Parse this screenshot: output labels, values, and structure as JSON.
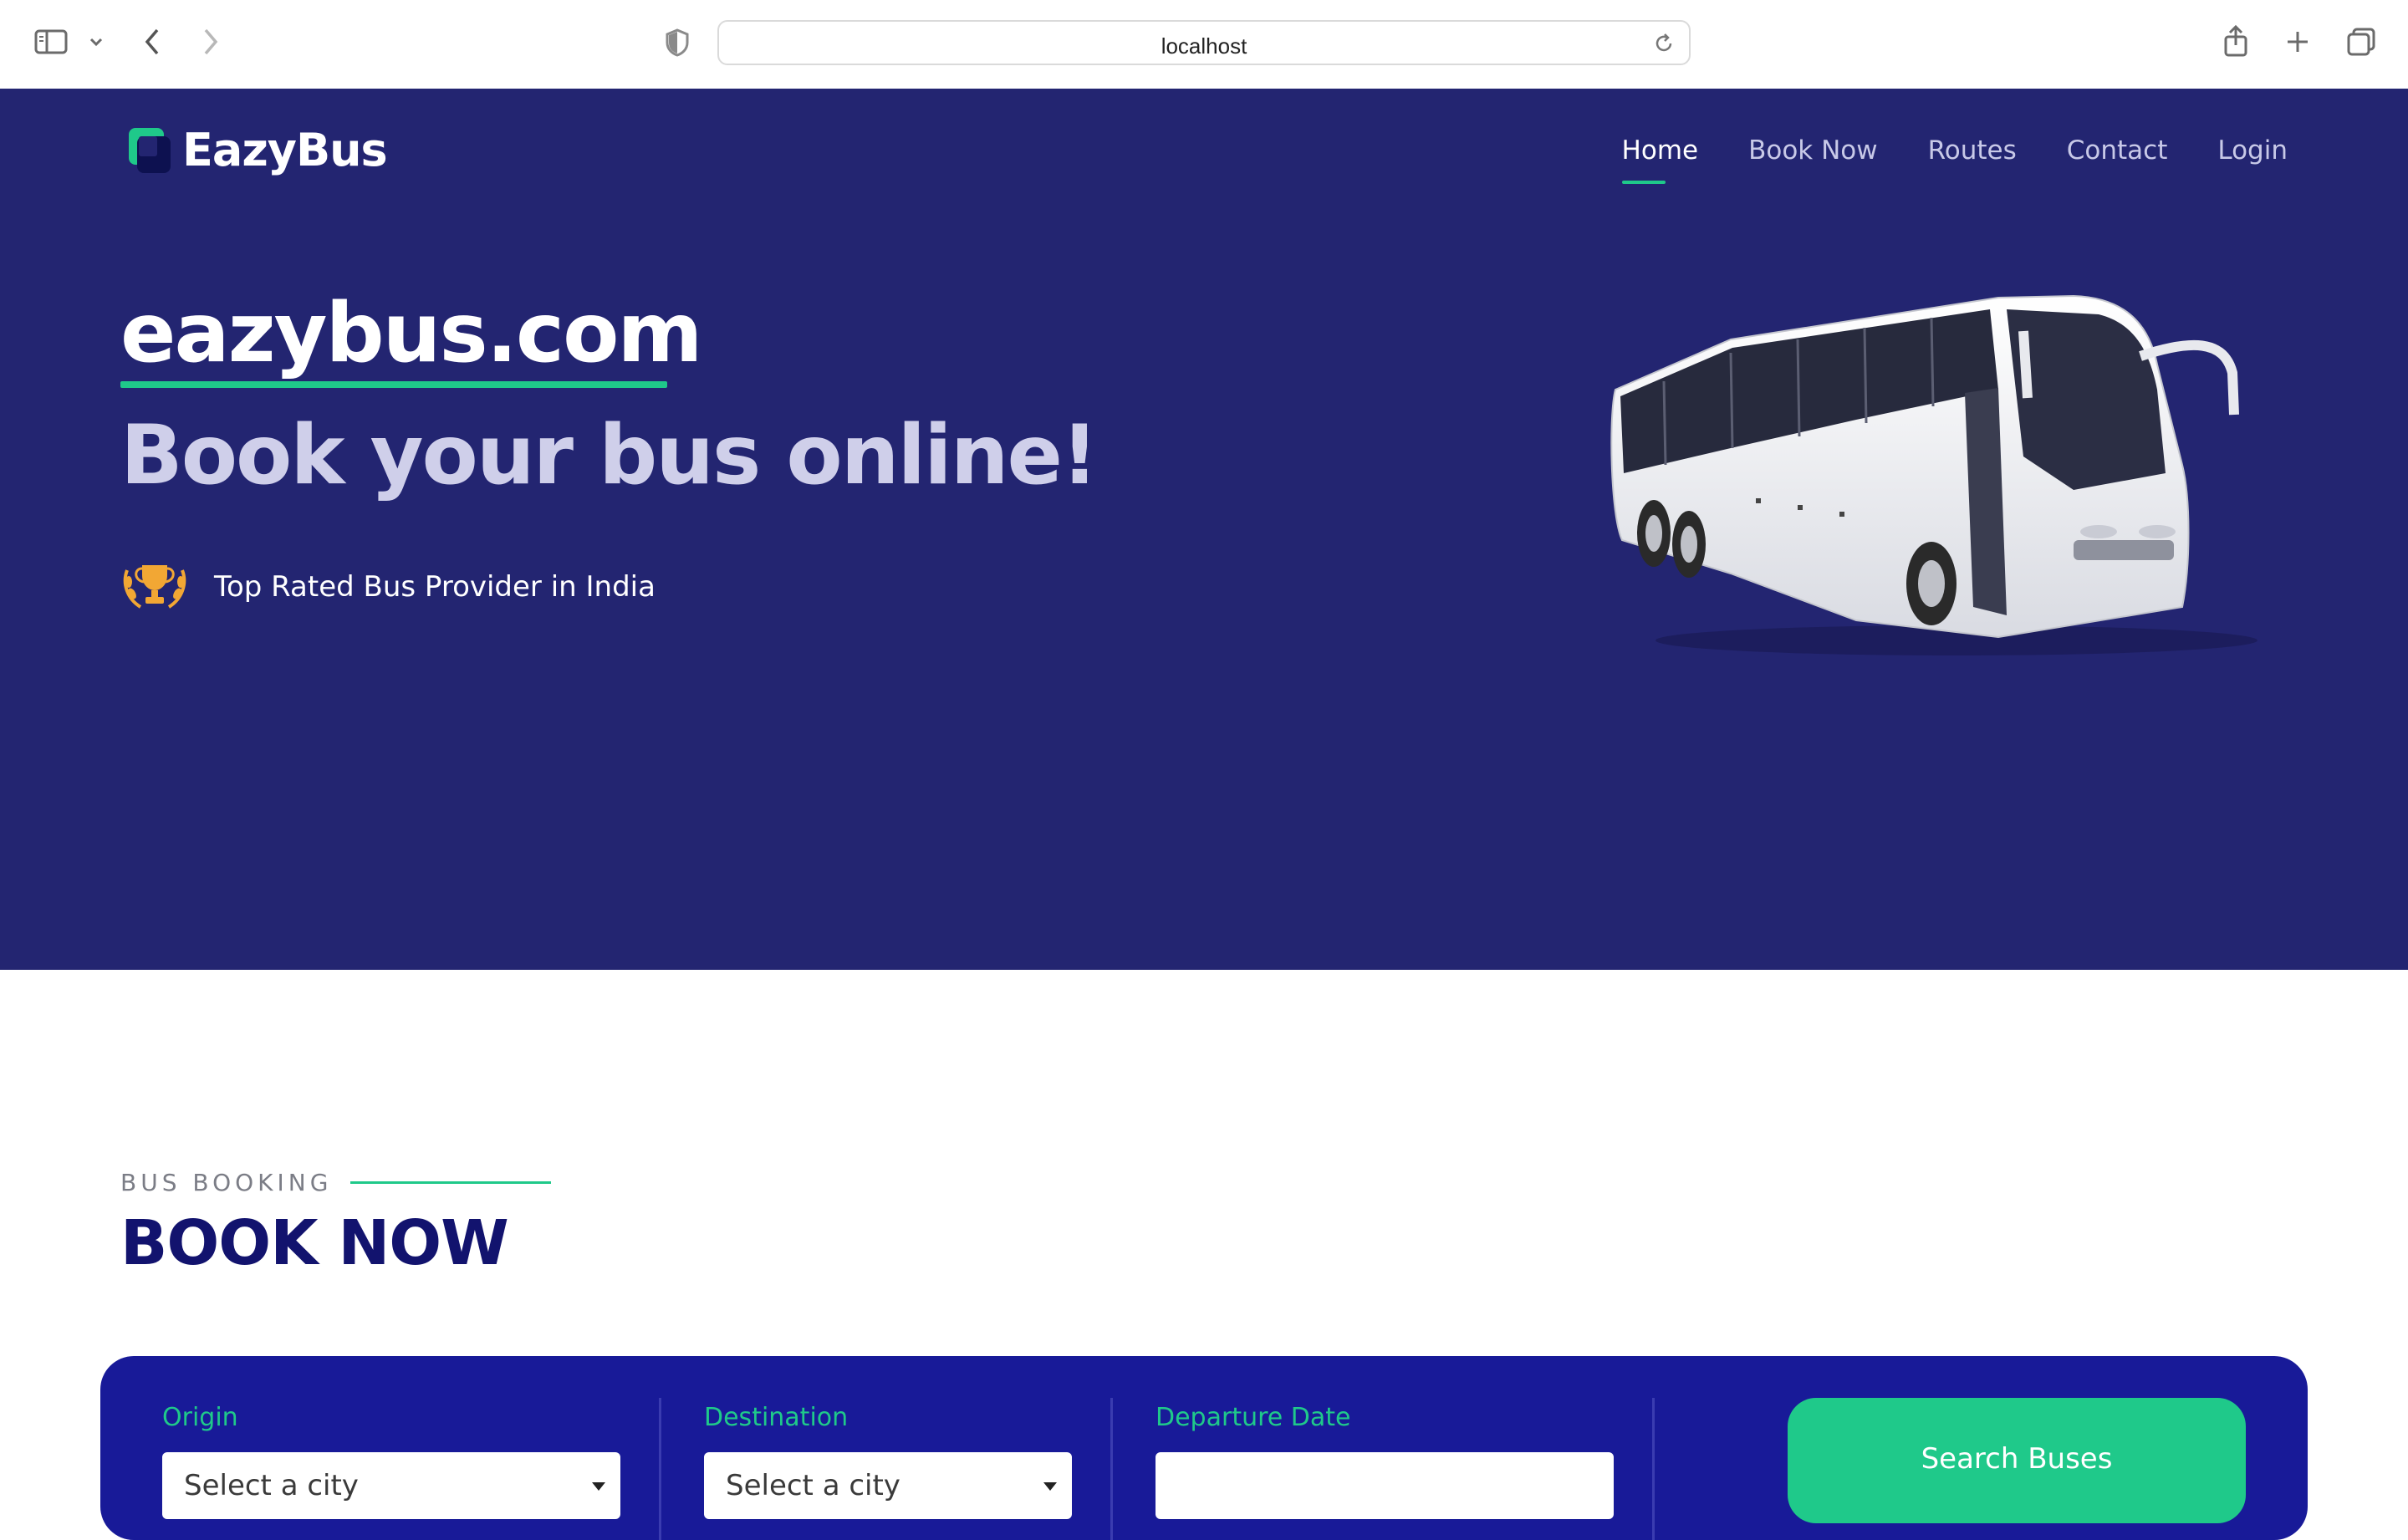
{
  "browser": {
    "url": "localhost",
    "icons": [
      "sidebar-icon",
      "chevron-down-icon",
      "back-icon",
      "forward-icon",
      "shield-icon",
      "reload-icon",
      "share-icon",
      "new-tab-icon",
      "tabs-icon"
    ]
  },
  "site": {
    "brand": "EazyBus",
    "nav": [
      "Home",
      "Book Now",
      "Routes",
      "Contact",
      "Login"
    ],
    "active_nav": "Home"
  },
  "hero": {
    "title": "eazybus.com",
    "subtitle": "Book your bus online!",
    "badge_text": "Top Rated Bus Provider in India"
  },
  "booking": {
    "kicker": "BUS BOOKING",
    "title": "BOOK NOW",
    "origin_label": "Origin",
    "origin_value": "Select a city",
    "destination_label": "Destination",
    "destination_value": "Select a city",
    "date_label": "Departure Date",
    "date_value": "",
    "search_button": "Search Buses"
  },
  "colors": {
    "hero_bg": "#232571",
    "accent": "#1fc98a",
    "booking_bg": "#181a98",
    "title": "#12136e"
  }
}
